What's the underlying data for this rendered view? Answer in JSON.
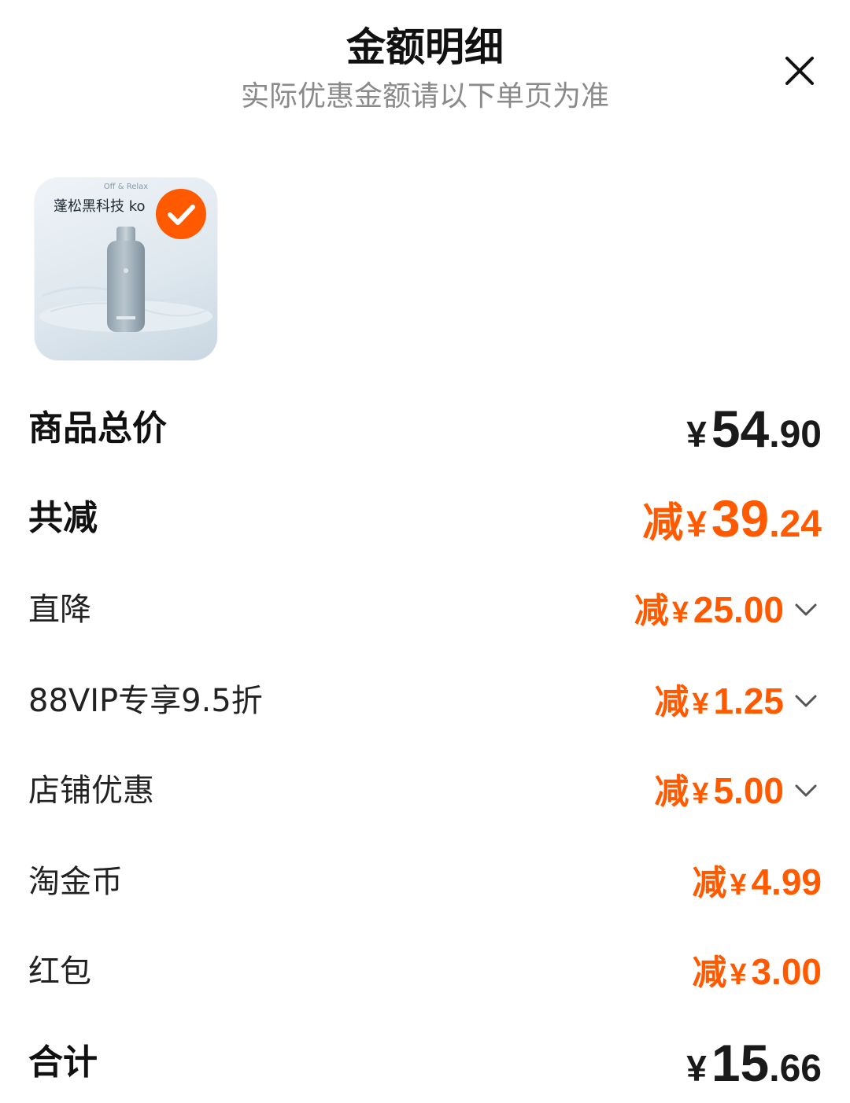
{
  "header": {
    "title": "金额明细",
    "subtitle": "实际优惠金额请以下单页为准"
  },
  "product": {
    "brand_text": "Off & Relax",
    "title_text": "蓬松黑科技 ko",
    "selected": true
  },
  "summary": {
    "total": {
      "label": "商品总价",
      "yen": "¥",
      "int": "54",
      "dec": ".90"
    },
    "discount_total": {
      "label": "共减",
      "prefix": "减",
      "yen": "¥",
      "int": "39",
      "dec": ".24"
    },
    "items": [
      {
        "label": "直降",
        "prefix": "减",
        "yen": "¥",
        "int": "25",
        "dec": ".00",
        "expandable": true
      },
      {
        "label": "88VIP专享9.5折",
        "prefix": "减",
        "yen": "¥",
        "int": "1",
        "dec": ".25",
        "expandable": true
      },
      {
        "label": "店铺优惠",
        "prefix": "减",
        "yen": "¥",
        "int": "5",
        "dec": ".00",
        "expandable": true
      },
      {
        "label": "淘金币",
        "prefix": "减",
        "yen": "¥",
        "int": "4",
        "dec": ".99",
        "expandable": false
      },
      {
        "label": "红包",
        "prefix": "减",
        "yen": "¥",
        "int": "3",
        "dec": ".00",
        "expandable": false
      }
    ],
    "grand_total": {
      "label": "合计",
      "yen": "¥",
      "int": "15",
      "dec": ".66"
    }
  },
  "colors": {
    "accent": "#ff5a00",
    "text": "#111111",
    "subtext": "#8a8a8a"
  },
  "icons": {
    "close": "close-icon",
    "check": "check-icon",
    "chevron": "chevron-down-icon"
  }
}
